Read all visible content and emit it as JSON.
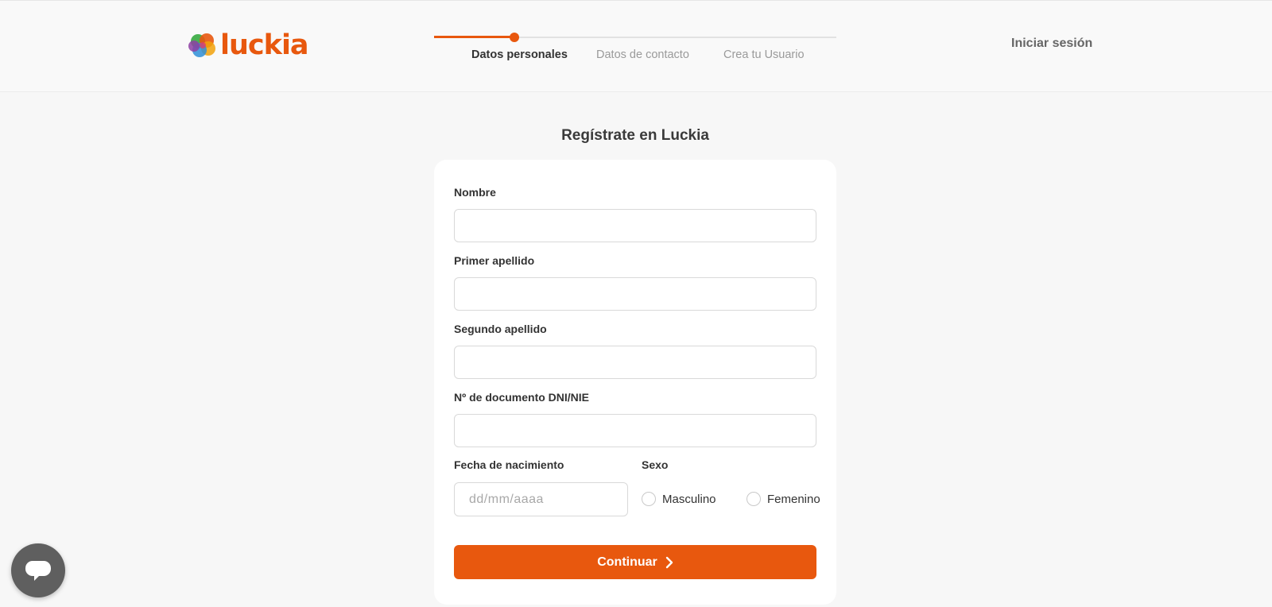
{
  "header": {
    "logo_text": "luckia",
    "login_label": "Iniciar sesión"
  },
  "stepper": {
    "progress": 0.2,
    "steps": [
      {
        "label": "Datos personales",
        "active": true
      },
      {
        "label": "Datos de contacto",
        "active": false
      },
      {
        "label": "Crea tu Usuario",
        "active": false
      }
    ]
  },
  "form": {
    "title": "Regístrate en Luckia",
    "nombre_label": "Nombre",
    "nombre_value": "",
    "primer_apellido_label": "Primer apellido",
    "primer_apellido_value": "",
    "segundo_apellido_label": "Segundo apellido",
    "segundo_apellido_value": "",
    "documento_label": "Nº de documento DNI/NIE",
    "documento_value": "",
    "fecha_label": "Fecha de nacimiento",
    "fecha_placeholder": "dd/mm/aaaa",
    "fecha_value": "",
    "sexo_label": "Sexo",
    "sexo_options": [
      "Masculino",
      "Femenino"
    ],
    "sexo_selected": null,
    "continue_label": "Continuar"
  },
  "colors": {
    "brand": "#e8580e",
    "chat_bubble": "#5f5f5f"
  },
  "icons": {
    "logo": "luckia-clover-icon",
    "continue": "chevron-right-icon",
    "chat": "chat-bubble-icon"
  }
}
